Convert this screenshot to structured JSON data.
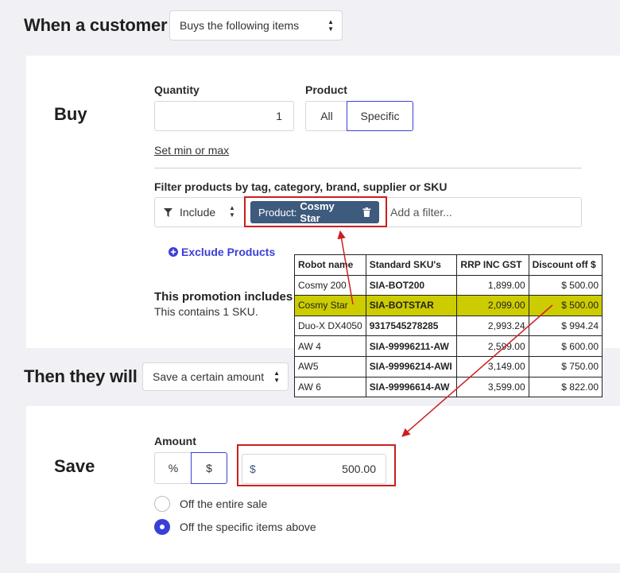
{
  "header": {
    "title": "When a customer",
    "condition_select": "Buys the following items"
  },
  "buy": {
    "heading": "Buy",
    "quantity_label": "Quantity",
    "quantity_value": "1",
    "product_label": "Product",
    "product_options": [
      "All",
      "Specific"
    ],
    "product_selected": "Specific",
    "set_min_max": "Set min or max",
    "filter_label": "Filter products by tag, category, brand, supplier or SKU",
    "include_select": "Include",
    "chip_prefix": "Product:",
    "chip_value": "Cosmy Star",
    "add_filter": "Add a filter...",
    "exclude_products": "Exclude Products",
    "promo_includes": "This promotion includes",
    "promo_contains": "This contains 1 SKU."
  },
  "sku_table": {
    "headers": [
      "Robot name",
      "Standard SKU's",
      "RRP INC GST",
      "Discount off $"
    ],
    "rows": [
      {
        "name": "Cosmy 200",
        "sku": "SIA-BOT200",
        "rrp": "1,899.00",
        "discount": "$ 500.00"
      },
      {
        "name": "Cosmy Star",
        "sku": "SIA-BOTSTAR",
        "rrp": "2,099.00",
        "discount": "$ 500.00"
      },
      {
        "name": "Duo-X DX4050",
        "sku": "9317545278285",
        "rrp": "2,993.24",
        "discount": "$ 994.24"
      },
      {
        "name": "AW 4",
        "sku": "SIA-99996211-AW",
        "rrp": "2,599.00",
        "discount": "$ 600.00"
      },
      {
        "name": "AW5",
        "sku": "SIA-99996214-AWI",
        "rrp": "3,149.00",
        "discount": "$ 750.00"
      },
      {
        "name": "AW 6",
        "sku": "SIA-99996614-AW",
        "rrp": "3,599.00",
        "discount": "$ 822.00"
      }
    ],
    "highlight_color": "#cccc00"
  },
  "then": {
    "title": "Then they will",
    "action_select": "Save a certain amount"
  },
  "save": {
    "heading": "Save",
    "amount_label": "Amount",
    "unit_options": [
      "%",
      "$"
    ],
    "unit_selected": "$",
    "amount_prefix": "$",
    "amount_value": "500.00",
    "radio_options": [
      "Off the entire sale",
      "Off the specific items above"
    ],
    "radio_selected": "Off the specific items above"
  },
  "colors": {
    "accent": "#3b3fd8",
    "annotation_red": "#cc1f1f",
    "chip_bg": "#3e5a7d"
  },
  "icons": [
    "chevron-up-down-icon",
    "filter-icon",
    "trash-icon",
    "plus-circle-icon"
  ]
}
